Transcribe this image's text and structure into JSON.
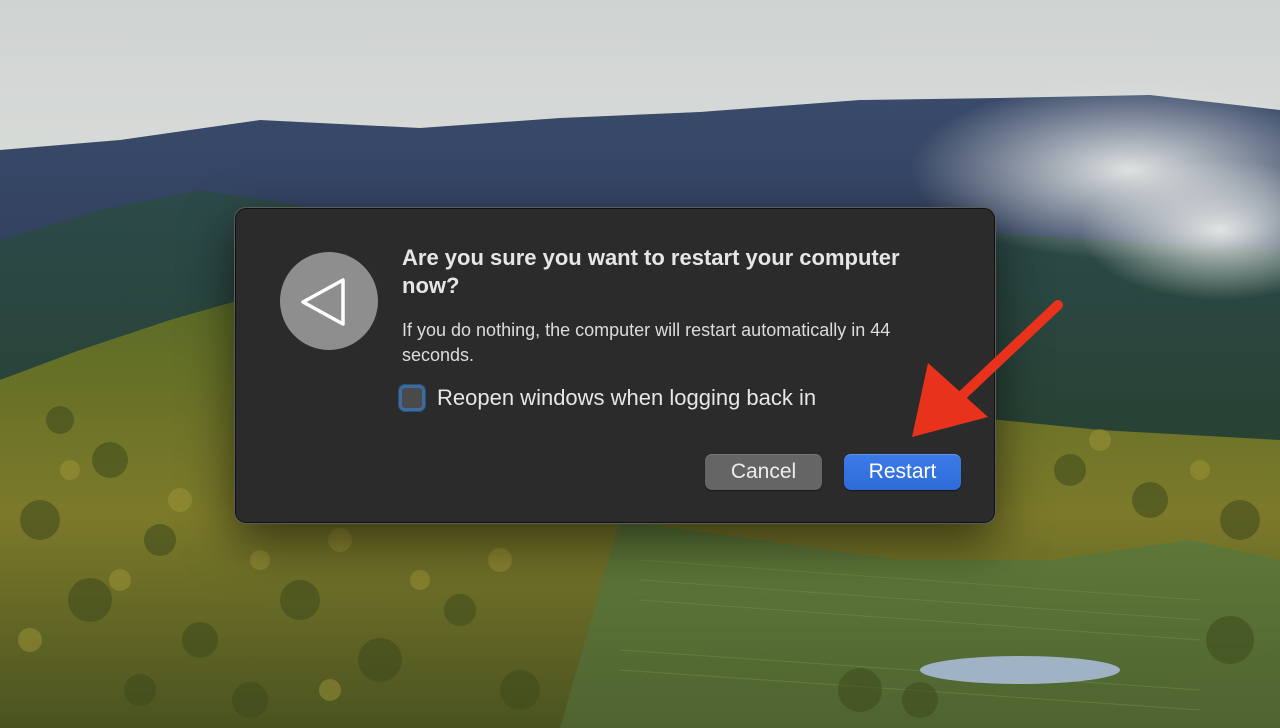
{
  "dialog": {
    "title": "Are you sure you want to restart your computer now?",
    "message": "If you do nothing, the computer will restart automatically in 44 seconds.",
    "countdown_seconds": 44,
    "checkbox": {
      "label": "Reopen windows when logging back in",
      "checked": false
    },
    "buttons": {
      "cancel_label": "Cancel",
      "restart_label": "Restart"
    },
    "icon": "restart-triangle-icon"
  },
  "annotation": {
    "icon": "red-arrow-icon",
    "color": "#e8321c",
    "points_to": "restart-button"
  },
  "colors": {
    "dialog_bg": "#2b2b2b",
    "primary_button": "#2f6cd8",
    "secondary_button": "#656565"
  }
}
